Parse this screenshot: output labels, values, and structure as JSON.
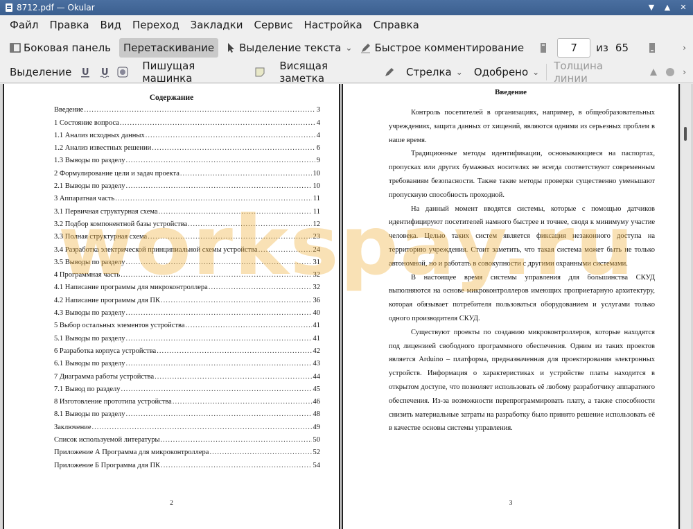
{
  "window": {
    "title": "8712.pdf  — Okular"
  },
  "menu": [
    "Файл",
    "Правка",
    "Вид",
    "Переход",
    "Закладки",
    "Сервис",
    "Настройка",
    "Справка"
  ],
  "toolbar1": {
    "sidebar": "Боковая панель",
    "drag": "Перетаскивание",
    "text_select": "Выделение текста",
    "quick_comment": "Быстрое комментирование",
    "page_current": "7",
    "page_of": "из",
    "page_total": "65"
  },
  "toolbar2": {
    "selection": "Выделение",
    "typewriter": "Пишущая машинка",
    "note": "Висящая заметка",
    "arrow": "Стрелка",
    "approved": "Одобрено",
    "line_width": "Толщина линии"
  },
  "left_page": {
    "title": "Содержание",
    "toc": [
      {
        "t": "Введение",
        "p": "3"
      },
      {
        "t": "1 Состояние вопроса",
        "p": "4"
      },
      {
        "t": "1.1 Анализ исходных данных",
        "p": "4"
      },
      {
        "t": "1.2 Анализ известных решении",
        "p": "6"
      },
      {
        "t": "1.3 Выводы по разделу",
        "p": "9"
      },
      {
        "t": "2 Формулирование цели и задач проекта",
        "p": "10"
      },
      {
        "t": "2.1 Выводы по разделу",
        "p": "10"
      },
      {
        "t": "3 Аппаратная часть",
        "p": "11"
      },
      {
        "t": "3.1 Первичная структурная схема",
        "p": "11"
      },
      {
        "t": "3.2 Подбор компонентной базы устройства",
        "p": "12"
      },
      {
        "t": "3.3 Полная структурная схема",
        "p": "23"
      },
      {
        "t": "3.4 Разработка электрической принципиальной схемы устройства",
        "p": "24"
      },
      {
        "t": "3.5 Выводы по разделу",
        "p": "31"
      },
      {
        "t": "4 Программная часть",
        "p": "32"
      },
      {
        "t": "4.1 Написание программы для микроконтроллера",
        "p": "32"
      },
      {
        "t": "4.2 Написание программы для ПК",
        "p": "36"
      },
      {
        "t": "4.3 Выводы по разделу",
        "p": "40"
      },
      {
        "t": "5 Выбор остальных элементов устройства",
        "p": "41"
      },
      {
        "t": "5.1 Выводы по разделу",
        "p": "41"
      },
      {
        "t": "6 Разработка корпуса устройства",
        "p": "42"
      },
      {
        "t": "6.1 Выводы по разделу",
        "p": "43"
      },
      {
        "t": "7 Диаграмма работы устройства",
        "p": "44"
      },
      {
        "t": "7.1 Вывод по разделу",
        "p": "45"
      },
      {
        "t": "8 Изготовление прототипа устройства",
        "p": "46"
      },
      {
        "t": "8.1 Выводы по разделу",
        "p": "48"
      },
      {
        "t": "Заключение",
        "p": "49"
      },
      {
        "t": "Список используемой литературы",
        "p": "50"
      },
      {
        "t": "Приложение А Программа для микроконтроллера",
        "p": "52"
      },
      {
        "t": "Приложение Б Программа для ПК",
        "p": "54"
      }
    ],
    "page_number": "2"
  },
  "right_page": {
    "title": "Введение",
    "paragraphs": [
      "Контроль посетителей в организациях, например, в общеобразовательных учреждениях, защита данных от хищений, являются одними из серьезных проблем в наше время.",
      "Традиционные методы идентификации, основывающиеся на паспортах, пропусках или других бумажных носителях не всегда соответствуют современным требованиям безопасности. Также такие методы проверки существенно уменьшают пропускную способность проходной.",
      "На данный момент вводятся системы, которые с помощью датчиков идентифицируют посетителей намного быстрее и точнее, сводя к минимуму участие человека. Целью таких систем является фиксация незаконного доступа на территорию учреждения. Стоит заметить, что такая система может быть не только автономной, но и работать в совокупности с другими охранными системами.",
      "В настоящее время системы управления для большинства СКУД выполняются на основе микроконтроллеров имеющих проприетарную архитектуру, которая обязывает потребителя пользоваться оборудованием и услугами только одного производителя СКУД.",
      "Существуют проекты по созданию микроконтроллеров, которые находятся под лицензией свободного программного обеспечения. Одним из таких проектов является Arduino – платформа, предназначенная для проектирования электронных устройств. Информация о характеристиках и устройстве платы находится в открытом доступе, что позволяет использовать её любому разработчику аппаратного обеспечения. Из-за возможности перепрограммировать плату, а также способности снизить материальные затраты на разработку было принято решение использовать её в качестве основы системы управления."
    ],
    "page_number": "3"
  },
  "watermark": "workspay.ru",
  "icons": {
    "app": "okular-icon",
    "minimize": "chevron-down-icon",
    "maximize": "chevron-up-icon",
    "close": "close-icon"
  }
}
